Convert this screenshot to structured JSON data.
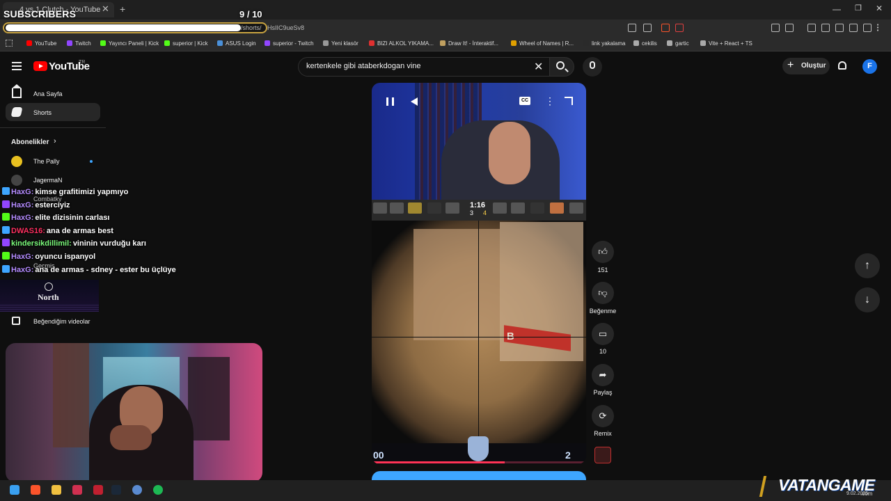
{
  "browser": {
    "tab_title": "4 vs 1 Clutch - YouTube",
    "tab_close": "✕",
    "new_tab": "+",
    "url_path": "/shorts/",
    "url_rest": "HsIIC9ueSv8",
    "win_min": "—",
    "win_max": "❐",
    "win_close": "✕",
    "bookmarks": [
      {
        "label": "YouTube",
        "color": "#ff0000"
      },
      {
        "label": "Twitch",
        "color": "#9146ff"
      },
      {
        "label": "Yayıncı Paneli | Kick",
        "color": "#53fc18"
      },
      {
        "label": "superior | Kick",
        "color": "#53fc18"
      },
      {
        "label": "ASUS Login",
        "color": "#4a90d9"
      },
      {
        "label": "superior - Twitch",
        "color": "#9146ff"
      },
      {
        "label": "Yeni klasör",
        "color": "#999999"
      },
      {
        "label": "BIZI ALKOL YIKAMA...",
        "color": "#e03030"
      },
      {
        "label": "Draw It! - İnteraktif...",
        "color": "#c0a060"
      },
      {
        "label": "Wheel of Names | R...",
        "color": "#e0a000"
      },
      {
        "label": "link yakalama",
        "color": "#2a2a2a"
      },
      {
        "label": "cekilis",
        "color": "#aaaaaa"
      },
      {
        "label": "gartic",
        "color": "#aaaaaa"
      },
      {
        "label": "Vite + React + TS",
        "color": "#aaaaaa"
      }
    ]
  },
  "stream_overlay": {
    "subscribers_label": "SUBSCRIBERS",
    "subscribers_counter": "9 / 10"
  },
  "youtube": {
    "logo_text": "YouTube",
    "region": "TR",
    "search_query": "kertenkele gibi ataberkdogan vine",
    "create_label": "Oluştur",
    "avatar_letter": "F",
    "sidebar": {
      "items": [
        {
          "label": "Ana Sayfa"
        },
        {
          "label": "Shorts"
        }
      ],
      "subscriptions_title": "Abonelikler",
      "channels": [
        {
          "name": "The Pally"
        },
        {
          "name": "JagermaN"
        },
        {
          "name": "Combatky"
        }
      ],
      "history_label": "Geçmiş",
      "liked_label": "Beğendiğim videolar"
    },
    "video": {
      "timer": "1:16",
      "score_ct": "3",
      "score_t": "4",
      "bottom_left": "00",
      "bottom_right": "2",
      "sign_letter": "B",
      "cc_label": "CC",
      "progress": 0.62
    },
    "actions": {
      "like_count": "151",
      "dislike_label": "Beğenme",
      "comment_count": "10",
      "share_label": "Paylaş",
      "remix_label": "Remix"
    }
  },
  "chat": [
    {
      "user": "HaxG:",
      "user_color": "#b58cff",
      "text": "kimse grafitimizi yapmıyo"
    },
    {
      "user": "HaxG:",
      "user_color": "#b58cff",
      "text": "esterciyiz"
    },
    {
      "user": "HaxG:",
      "user_color": "#b58cff",
      "text": "elite dizisinin carlası"
    },
    {
      "user": "DWAS16:",
      "user_color": "#ff3060",
      "text": "ana de armas best"
    },
    {
      "user": "kindersikdillimil:",
      "user_color": "#7cfc7c",
      "text": "vininin vurduğu karı"
    },
    {
      "user": "HaxG:",
      "user_color": "#b58cff",
      "text": "oyuncu ispanyol"
    },
    {
      "user": "HaxG:",
      "user_color": "#b58cff",
      "text": "ana de armas - sdney - ester bu üçlüye"
    }
  ],
  "banner": {
    "north_text": "North"
  },
  "watermark": {
    "brand": "VATANGAME",
    "suffix": ".com",
    "date": "9.02.2025"
  }
}
